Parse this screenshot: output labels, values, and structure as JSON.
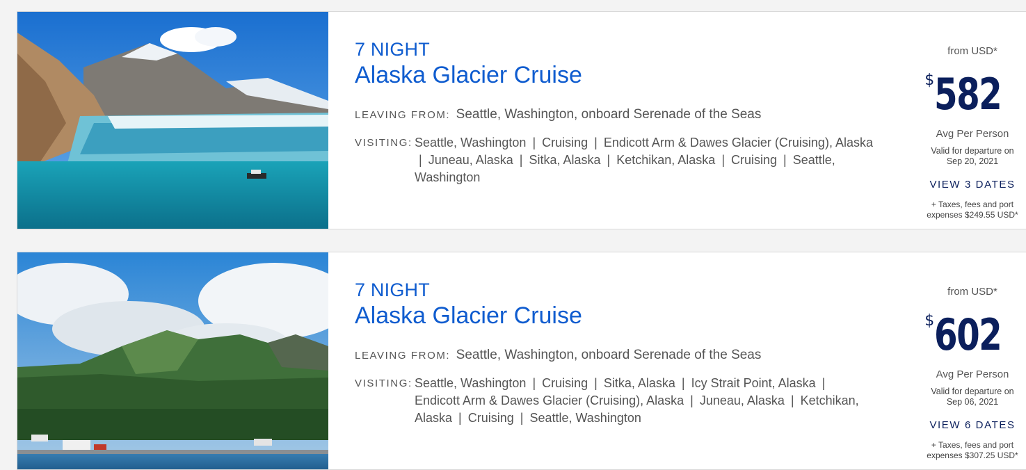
{
  "cruises": [
    {
      "nights": "7 NIGHT",
      "title": "Alaska Glacier Cruise",
      "leaving_label": "LEAVING FROM:",
      "leaving_value": "Seattle, Washington, onboard Serenade of the Seas",
      "visiting_label": "VISITING:",
      "stops": [
        "Seattle, Washington",
        "Cruising",
        "Endicott Arm & Dawes Glacier (Cruising), Alaska",
        "Juneau, Alaska",
        "Sitka, Alaska",
        "Ketchikan, Alaska",
        "Cruising",
        "Seattle, Washington"
      ],
      "from_label": "from USD*",
      "currency_symbol": "$",
      "price": "582",
      "avg_label": "Avg Per Person",
      "valid_line1": "Valid for departure on",
      "valid_line2": "Sep 20, 2021",
      "view_dates": "VIEW 3 DATES",
      "taxes_line1": "+ Taxes, fees and port",
      "taxes_line2": "expenses $249.55 USD*",
      "image_icon": "glacier-photo"
    },
    {
      "nights": "7 NIGHT",
      "title": "Alaska Glacier Cruise",
      "leaving_label": "LEAVING FROM:",
      "leaving_value": "Seattle, Washington, onboard Serenade of the Seas",
      "visiting_label": "VISITING:",
      "stops": [
        "Seattle, Washington",
        "Cruising",
        "Sitka, Alaska",
        "Icy Strait Point, Alaska",
        "Endicott Arm & Dawes Glacier (Cruising), Alaska",
        "Juneau, Alaska",
        "Ketchikan, Alaska",
        "Cruising",
        "Seattle, Washington"
      ],
      "from_label": "from USD*",
      "currency_symbol": "$",
      "price": "602",
      "avg_label": "Avg Per Person",
      "valid_line1": "Valid for departure on",
      "valid_line2": "Sep 06, 2021",
      "view_dates": "VIEW 6 DATES",
      "taxes_line1": "+ Taxes, fees and port",
      "taxes_line2": "expenses $307.25 USD*",
      "image_icon": "mountain-photo"
    }
  ],
  "colors": {
    "title_blue": "#0f5ccf",
    "price_navy": "#0b1f5c",
    "text_gray": "#555555"
  }
}
